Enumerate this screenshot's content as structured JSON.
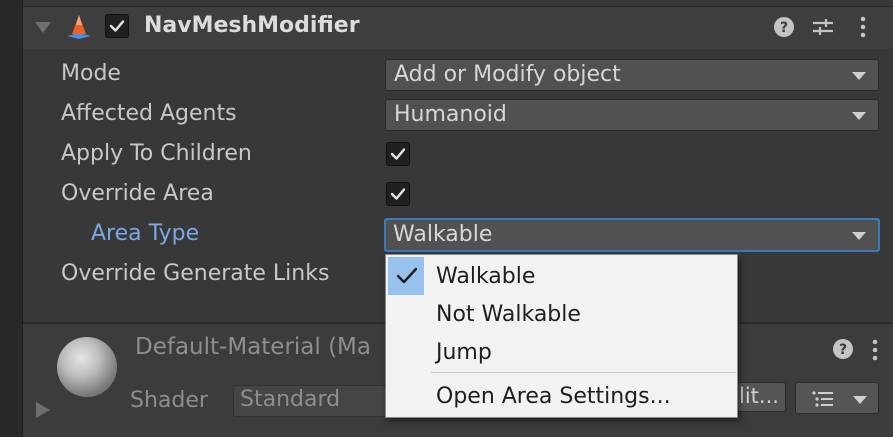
{
  "component": {
    "title": "NavMeshModifier",
    "enabled": true,
    "icons": [
      "help-icon",
      "presets-icon",
      "more-vert-icon"
    ]
  },
  "fields": {
    "mode": {
      "label": "Mode",
      "value": "Add or Modify object"
    },
    "affected_agents": {
      "label": "Affected Agents",
      "value": "Humanoid"
    },
    "apply_to_children": {
      "label": "Apply To Children",
      "checked": true
    },
    "override_area": {
      "label": "Override Area",
      "checked": true
    },
    "area_type": {
      "label": "Area Type",
      "value": "Walkable"
    },
    "override_generate_links": {
      "label": "Override Generate Links"
    }
  },
  "material": {
    "name": "Default-Material (Ma",
    "shader_label": "Shader",
    "shader_value": "Standard",
    "edit_label": "lit..."
  },
  "popup_menu": {
    "items": [
      {
        "label": "Walkable",
        "checked": true
      },
      {
        "label": "Not Walkable",
        "checked": false
      },
      {
        "label": "Jump",
        "checked": false
      }
    ],
    "footer_item": "Open Area Settings..."
  },
  "colors": {
    "accent_blue": "#3a79bb",
    "label_blue": "#7aa7e6",
    "nav_icon_orange": "#e8622a",
    "nav_icon_blue": "#4a8fd9"
  }
}
